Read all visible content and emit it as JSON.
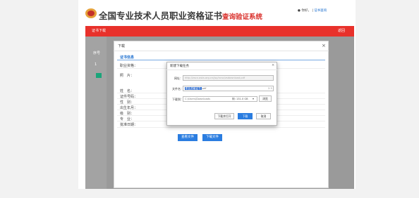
{
  "site": {
    "title": "全国专业技术人员职业资格证书",
    "title_suffix": "查询验证系统",
    "top_links": {
      "user": "你好，",
      "sep": "| ",
      "cert": "证书查询"
    }
  },
  "navbar": {
    "left": "证书下载",
    "right": "返回"
  },
  "background_table": {
    "header_left": "序号",
    "header_right": "操作",
    "row_number": "1",
    "button_left": "",
    "button_right_1": "查看详情",
    "button_right_2": "下载"
  },
  "dialog": {
    "title": "下载",
    "close": "×",
    "section_title": "证书信息",
    "fields": [
      {
        "label": "职业资格："
      },
      {
        "label": "照　片："
      },
      {
        "label": "姓　名："
      },
      {
        "label": "证件号码："
      },
      {
        "label": "性　别："
      },
      {
        "label": "出生年月："
      },
      {
        "label": "级　别："
      },
      {
        "label": "专　业："
      },
      {
        "label": "批准日期："
      }
    ],
    "buttons": {
      "view": "查看文件",
      "download": "下载文件"
    }
  },
  "download_dialog": {
    "title": "新建下载任务",
    "close": "×",
    "url_label": "网址：",
    "url_value": "http://zscx.osta.org.cn/jsp/ncsc/zsdownload.pdf",
    "filename_label": "文件名：",
    "filename_selected": "职业资格证书",
    "filename_ext": ".pdf",
    "filesize": "2.3",
    "saveto_label": "下载到：",
    "saveto_path": "C:\\Users\\Downloads",
    "free_space": "剩: 131.0 GB",
    "browse": "浏览",
    "btn_open": "下载并打开",
    "btn_download": "下载",
    "btn_cancel": "取消"
  }
}
